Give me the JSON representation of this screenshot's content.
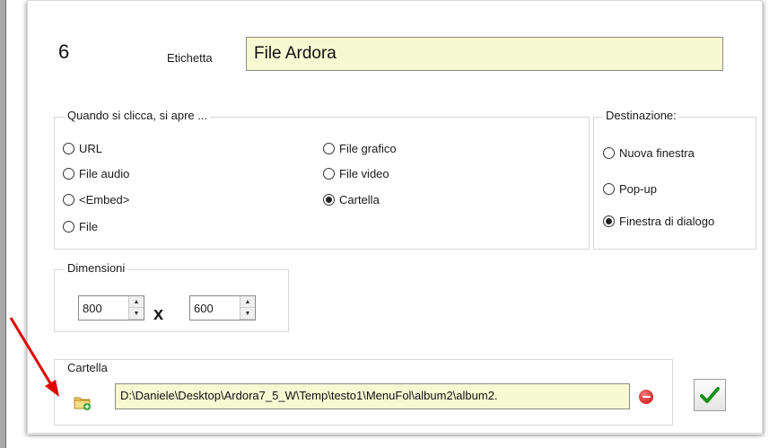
{
  "item_number": "6",
  "label": {
    "caption": "Etichetta",
    "value": "File Ardora"
  },
  "open_group": {
    "legend": "Quando si clicca, si apre ...",
    "options": [
      "URL",
      "File audio",
      "<Embed>",
      "File",
      "File grafico",
      "File video",
      "Cartella"
    ],
    "selected": "Cartella"
  },
  "destination_group": {
    "legend": "Destinazione:",
    "options": [
      "Nuova finestra",
      "Pop-up",
      "Finestra di dialogo"
    ],
    "selected": "Finestra di dialogo"
  },
  "dimensions": {
    "legend": "Dimensioni",
    "width": "800",
    "separator": "x",
    "height": "600"
  },
  "folder": {
    "legend": "Cartella",
    "path": "D:\\Daniele\\Desktop\\Ardora7_5_W\\Temp\\testo1\\MenuFol\\album2\\album2."
  },
  "colors": {
    "input_bg": "#f6f9d2",
    "annotation_arrow": "#e00000",
    "ok_check": "#1a8f1a",
    "remove": "#d6272a"
  },
  "icons": {
    "folder": "folder-add-icon",
    "remove": "remove-icon",
    "ok": "checkmark-icon"
  }
}
